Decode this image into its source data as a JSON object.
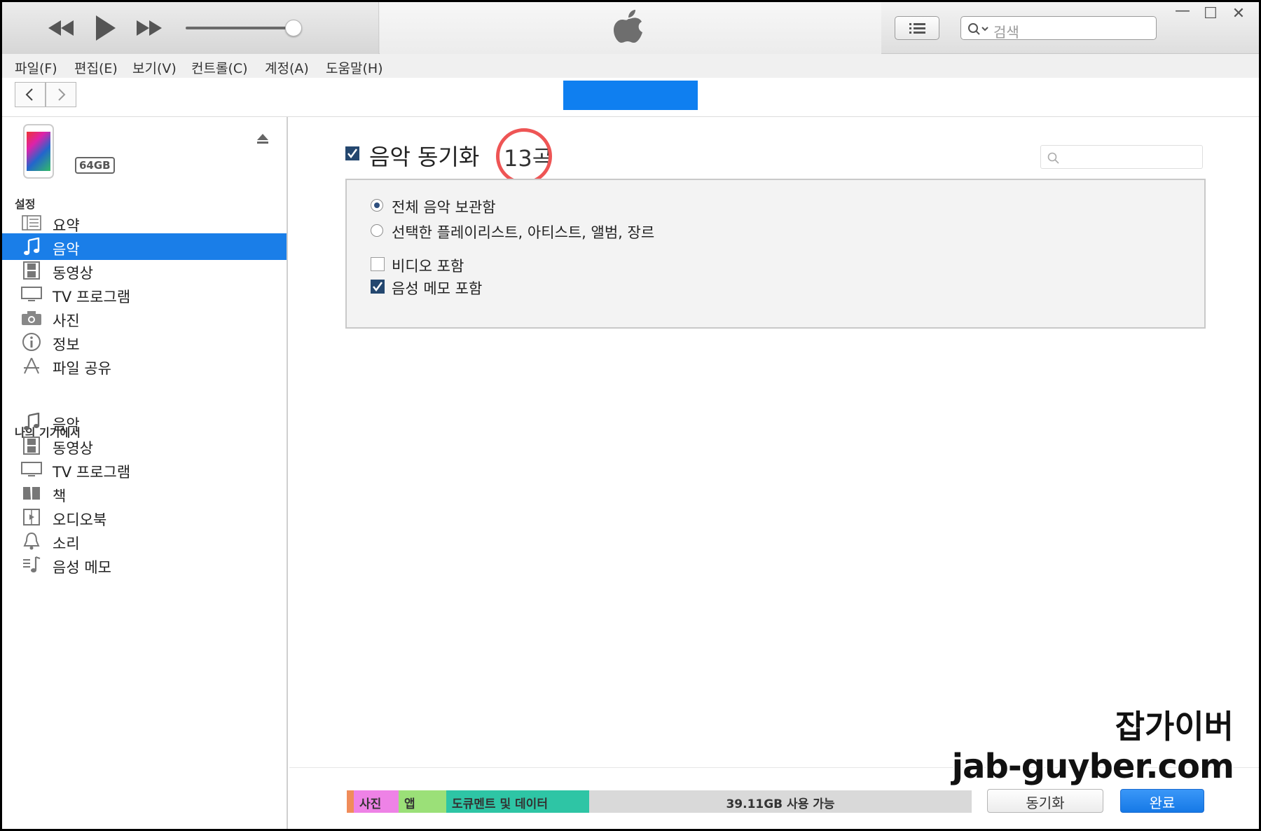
{
  "search": {
    "placeholder": "검색"
  },
  "menu": [
    "파일(F)",
    "편집(E)",
    "보기(V)",
    "컨트롤(C)",
    "계정(A)",
    "도움말(H)"
  ],
  "device": {
    "capacity": "64GB"
  },
  "sidebar": {
    "settings_title": "설정",
    "settings_items": [
      {
        "label": "요약",
        "icon": "summary-icon"
      },
      {
        "label": "음악",
        "icon": "music-note-icon",
        "selected": true
      },
      {
        "label": "동영상",
        "icon": "film-icon"
      },
      {
        "label": "TV 프로그램",
        "icon": "tv-icon"
      },
      {
        "label": "사진",
        "icon": "camera-icon"
      },
      {
        "label": "정보",
        "icon": "info-icon"
      },
      {
        "label": "파일 공유",
        "icon": "app-store-icon"
      }
    ],
    "device_title": "나의 기기에서",
    "device_items": [
      {
        "label": "음악",
        "icon": "music-note-icon"
      },
      {
        "label": "동영상",
        "icon": "film-icon"
      },
      {
        "label": "TV 프로그램",
        "icon": "tv-icon"
      },
      {
        "label": "책",
        "icon": "book-icon"
      },
      {
        "label": "오디오북",
        "icon": "audiobook-icon"
      },
      {
        "label": "소리",
        "icon": "bell-icon"
      },
      {
        "label": "음성 메모",
        "icon": "voice-memo-icon"
      }
    ]
  },
  "main": {
    "sync_title": "음악 동기화",
    "sync_checked": true,
    "song_count": "13곡",
    "options": [
      {
        "type": "radio",
        "label": "전체 음악 보관함",
        "checked": true
      },
      {
        "type": "radio",
        "label": "선택한 플레이리스트, 아티스트, 앨범, 장르",
        "checked": false
      },
      {
        "type": "checkbox",
        "label": "비디오 포함",
        "checked": false
      },
      {
        "type": "checkbox",
        "label": "음성 메모 포함",
        "checked": true
      }
    ]
  },
  "footer": {
    "storage_segments": [
      {
        "label": "",
        "color": "#f08c5a"
      },
      {
        "label": "사진",
        "color": "#ee82e6"
      },
      {
        "label": "앱",
        "color": "#9be078"
      },
      {
        "label": "도큐멘트 및 데이터",
        "color": "#2ec5a5"
      },
      {
        "label": "39.11GB 사용 가능",
        "color": "#d9d9d9"
      }
    ],
    "sync_button": "동기화",
    "done_button": "완료"
  },
  "watermark": {
    "line1": "잡가이버",
    "line2": "jab-guyber.com"
  },
  "colors": {
    "accent": "#1a7ee8",
    "highlight_circle": "#ee5555"
  }
}
